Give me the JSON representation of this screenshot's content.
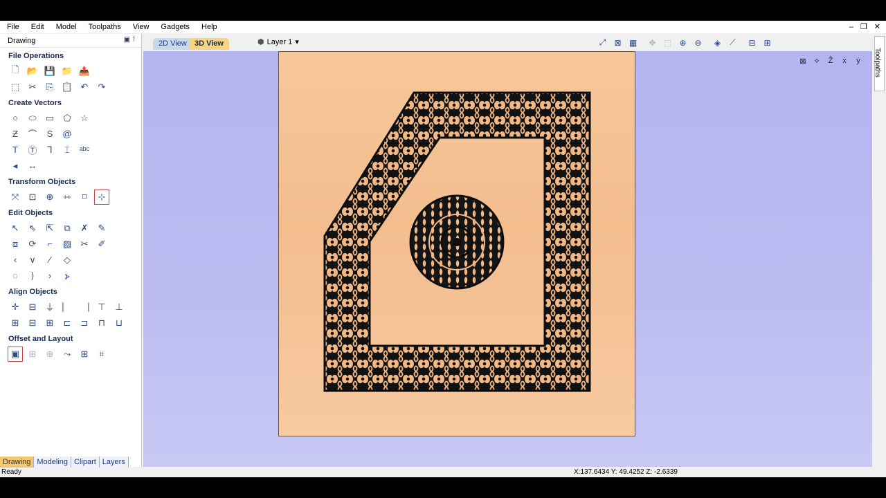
{
  "menu": [
    "File",
    "Edit",
    "Model",
    "Toolpaths",
    "View",
    "Gadgets",
    "Help"
  ],
  "window_controls": [
    "–",
    "❐",
    "✕"
  ],
  "panel": {
    "title": "Drawing",
    "sections": [
      {
        "title": "File Operations",
        "rows": [
          [
            {
              "n": "new-file-icon",
              "g": "🗋"
            },
            {
              "n": "open-folder-icon",
              "g": "📂",
              "c": "folder"
            },
            {
              "n": "save-icon",
              "g": "💾"
            },
            {
              "n": "import-folder-icon",
              "g": "📁",
              "c": "folder"
            },
            {
              "n": "export-folder-icon",
              "g": "📤",
              "c": "folder"
            }
          ],
          [
            {
              "n": "select-all-icon",
              "g": "⬚"
            },
            {
              "n": "cut-icon",
              "g": "✂"
            },
            {
              "n": "copy-icon",
              "g": "⎘"
            },
            {
              "n": "paste-icon",
              "g": "📋"
            },
            {
              "n": "undo-icon",
              "g": "↶"
            },
            {
              "n": "redo-icon",
              "g": "↷"
            }
          ]
        ]
      },
      {
        "title": "Create Vectors",
        "rows": [
          [
            {
              "n": "circle-icon",
              "g": "○"
            },
            {
              "n": "ellipse-icon",
              "g": "⬭"
            },
            {
              "n": "rectangle-icon",
              "g": "▭"
            },
            {
              "n": "polygon-icon",
              "g": "⬠"
            },
            {
              "n": "star-icon",
              "g": "☆"
            }
          ],
          [
            {
              "n": "polyline-icon",
              "g": "Ƶ"
            },
            {
              "n": "arc-icon",
              "g": "⌒"
            },
            {
              "n": "spiral-s-icon",
              "g": "S"
            },
            {
              "n": "spiral-icon",
              "g": "@"
            }
          ],
          [
            {
              "n": "text-icon",
              "g": "T"
            },
            {
              "n": "text-block-icon",
              "g": "Ⓣ"
            },
            {
              "n": "text-on-curve-icon",
              "g": "Ꞁ"
            },
            {
              "n": "dimension-text-icon",
              "g": "⌶"
            },
            {
              "n": "abc-icon",
              "g": "ᵃᵇᶜ"
            }
          ],
          [
            {
              "n": "draw-freehand-icon",
              "g": "◂"
            },
            {
              "n": "dimension-icon",
              "g": "↔"
            }
          ]
        ]
      },
      {
        "title": "Transform Objects",
        "rows": [
          [
            {
              "n": "move-icon",
              "g": "⤧"
            },
            {
              "n": "scale-icon",
              "g": "⊡"
            },
            {
              "n": "rotate-icon",
              "g": "⊕"
            },
            {
              "n": "mirror-icon",
              "g": "⇿"
            },
            {
              "n": "distort-icon",
              "g": "⌑"
            },
            {
              "n": "set-origin-icon",
              "g": "⊹",
              "c": "sel"
            }
          ]
        ]
      },
      {
        "title": "Edit Objects",
        "rows": [
          [
            {
              "n": "select-pointer-icon",
              "g": "↖"
            },
            {
              "n": "node-edit-icon",
              "g": "⇖"
            },
            {
              "n": "transform-mode-icon",
              "g": "⇱"
            },
            {
              "n": "group-icon",
              "g": "⧉"
            },
            {
              "n": "ungroup-icon",
              "g": "✗"
            },
            {
              "n": "measure-icon",
              "g": "✎"
            }
          ],
          [
            {
              "n": "weld-icon",
              "g": "⧈"
            },
            {
              "n": "trim-icon",
              "g": "⟳"
            },
            {
              "n": "fillet-icon",
              "g": "⌐"
            },
            {
              "n": "offset-edit-icon",
              "g": "▨"
            },
            {
              "n": "scissors-icon",
              "g": "✂"
            },
            {
              "n": "smart-icon",
              "g": "✐"
            }
          ],
          [
            {
              "n": "curve-left-icon",
              "g": "‹"
            },
            {
              "n": "v-node-icon",
              "g": "∨"
            },
            {
              "n": "line-icon",
              "g": "∕"
            },
            {
              "n": "diamond-nodes-icon",
              "g": "◇"
            }
          ],
          [
            {
              "n": "close-vector-icon",
              "g": "◌"
            },
            {
              "n": "join-icon",
              "g": "⟩"
            },
            {
              "n": "extend-icon",
              "g": "›"
            },
            {
              "n": "curve-fit-icon",
              "g": "⦔"
            }
          ]
        ]
      },
      {
        "title": "Align Objects",
        "rows": [
          [
            {
              "n": "align-center-icon",
              "g": "✛"
            },
            {
              "n": "align-hcenter-icon",
              "g": "⊟"
            },
            {
              "n": "align-vcenter-icon",
              "g": "⏚"
            },
            {
              "n": "align-left-icon",
              "g": "⎸"
            },
            {
              "n": "align-right-icon",
              "g": "⎹"
            },
            {
              "n": "align-top-icon",
              "g": "⊤"
            },
            {
              "n": "align-bottom-icon",
              "g": "⊥"
            }
          ],
          [
            {
              "n": "space-both-icon",
              "g": "⊞"
            },
            {
              "n": "space-horiz-icon",
              "g": "⊟"
            },
            {
              "n": "space-vert-icon",
              "g": "⊞"
            },
            {
              "n": "size-width-icon",
              "g": "⊏"
            },
            {
              "n": "size-height-icon",
              "g": "⊐"
            },
            {
              "n": "size-a-icon",
              "g": "⊓"
            },
            {
              "n": "size-b-icon",
              "g": "⊔"
            }
          ]
        ]
      },
      {
        "title": "Offset and Layout",
        "rows": [
          [
            {
              "n": "offset-icon",
              "g": "▣",
              "c": "sel"
            },
            {
              "n": "array-icon",
              "g": "⊞",
              "c": "disabled"
            },
            {
              "n": "circular-array-icon",
              "g": "⊕",
              "c": "disabled"
            },
            {
              "n": "copy-along-icon",
              "g": "⤳"
            },
            {
              "n": "nest-icon",
              "g": "⊞"
            },
            {
              "n": "layout-icon",
              "g": "⌗"
            }
          ]
        ]
      }
    ]
  },
  "bottom_tabs": [
    "Drawing",
    "Modeling",
    "Clipart",
    "Layers"
  ],
  "view_tabs": {
    "tab2d": "2D View",
    "tab3d": "3D View"
  },
  "layer": {
    "label": "Layer 1",
    "arrow": "▾"
  },
  "view_icons": [
    {
      "n": "zoom-extents-icon",
      "g": "⤢"
    },
    {
      "n": "zoom-material-icon",
      "g": "⊠"
    },
    {
      "n": "grid-icon",
      "g": "▦"
    },
    {
      "n": "pan-icon",
      "g": "✥",
      "c": "disabled"
    },
    {
      "n": "zoom-box-icon",
      "g": "⬚",
      "c": "disabled"
    },
    {
      "n": "zoom-in-icon",
      "g": "⊕"
    },
    {
      "n": "zoom-out-icon",
      "g": "⊖"
    },
    {
      "n": "render-icon",
      "g": "◈"
    },
    {
      "n": "toolpath-preview-icon",
      "g": "⟋"
    },
    {
      "n": "split-horizontal-icon",
      "g": "⊟"
    },
    {
      "n": "split-vertical-icon",
      "g": "⊞"
    }
  ],
  "corner_icons": [
    {
      "n": "view-extents-icon",
      "g": "⊠"
    },
    {
      "n": "iso-view-icon",
      "g": "⟡"
    },
    {
      "n": "z-view-icon",
      "g": "Ẑ"
    },
    {
      "n": "x-view-icon",
      "g": "ẋ"
    },
    {
      "n": "y-view-icon",
      "g": "ẏ"
    }
  ],
  "right_tab": "Toolpaths",
  "status": {
    "text": "Ready",
    "coords": "X:137.6434 Y: 49.4252 Z: -2.6339"
  },
  "colors": {
    "board": "#f4c090",
    "carve": "#111111",
    "viewport": "#b8b8f0"
  }
}
